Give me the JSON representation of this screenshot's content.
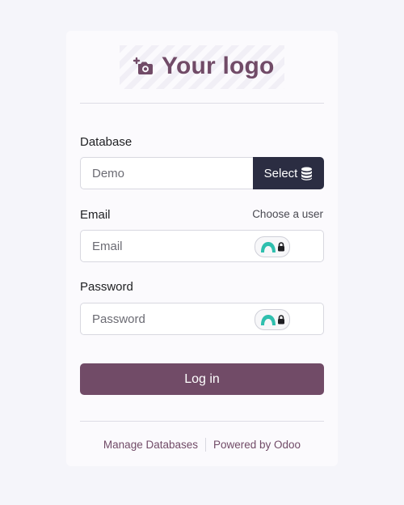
{
  "logo": {
    "text": "Your logo",
    "icon": "camera-add-icon",
    "color": "#714b67"
  },
  "database": {
    "label": "Database",
    "placeholder": "Demo",
    "select_label": "Select",
    "select_icon": "database-icon"
  },
  "email": {
    "label": "Email",
    "choose_user": "Choose a user",
    "placeholder": "Email"
  },
  "password": {
    "label": "Password",
    "placeholder": "Password"
  },
  "password_manager_icon": "password-manager-lock-icon",
  "login": {
    "label": "Log in"
  },
  "footer": {
    "manage_databases": "Manage Databases",
    "powered_by": "Powered by Odoo"
  },
  "colors": {
    "primary": "#714b67",
    "select_button": "#2b2d42",
    "background": "#f5f5fa"
  }
}
